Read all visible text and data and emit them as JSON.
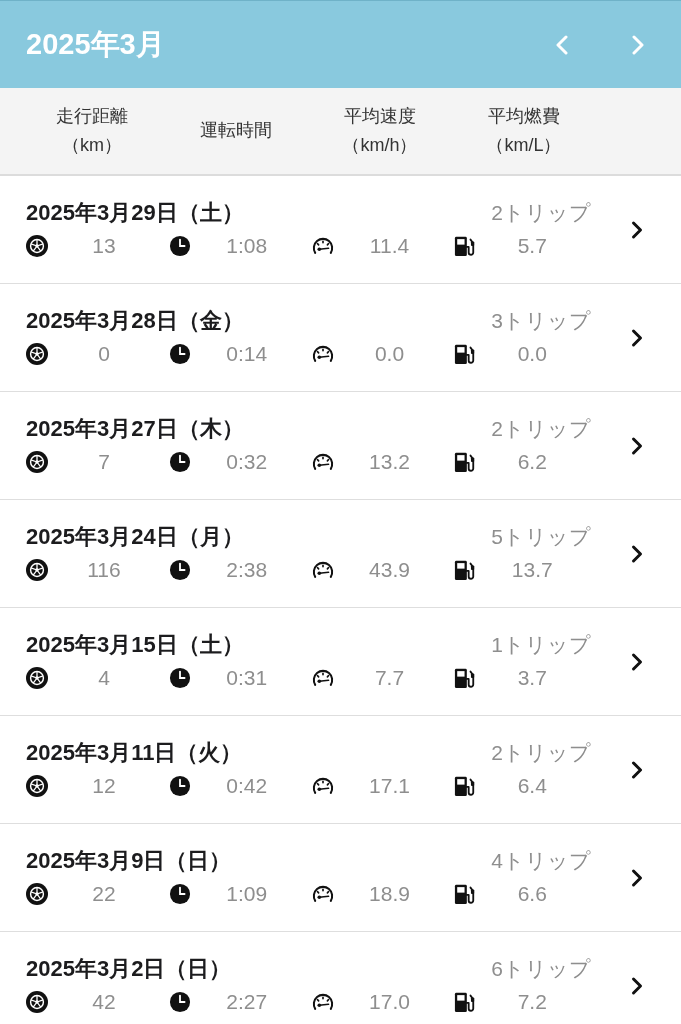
{
  "header": {
    "title": "2025年3月"
  },
  "columns": [
    {
      "label": "走行距離",
      "unit": "（km）"
    },
    {
      "label": "運転時間"
    },
    {
      "label": "平均速度",
      "unit": "（km/h）"
    },
    {
      "label": "平均燃費",
      "unit": "（km/L）"
    }
  ],
  "days": [
    {
      "date": "2025年3月29日（土）",
      "trips": "2トリップ",
      "distance": "13",
      "time": "1:08",
      "speed": "11.4",
      "fuel_economy": "5.7"
    },
    {
      "date": "2025年3月28日（金）",
      "trips": "3トリップ",
      "distance": "0",
      "time": "0:14",
      "speed": "0.0",
      "fuel_economy": "0.0"
    },
    {
      "date": "2025年3月27日（木）",
      "trips": "2トリップ",
      "distance": "7",
      "time": "0:32",
      "speed": "13.2",
      "fuel_economy": "6.2"
    },
    {
      "date": "2025年3月24日（月）",
      "trips": "5トリップ",
      "distance": "116",
      "time": "2:38",
      "speed": "43.9",
      "fuel_economy": "13.7"
    },
    {
      "date": "2025年3月15日（土）",
      "trips": "1トリップ",
      "distance": "4",
      "time": "0:31",
      "speed": "7.7",
      "fuel_economy": "3.7"
    },
    {
      "date": "2025年3月11日（火）",
      "trips": "2トリップ",
      "distance": "12",
      "time": "0:42",
      "speed": "17.1",
      "fuel_economy": "6.4"
    },
    {
      "date": "2025年3月9日（日）",
      "trips": "4トリップ",
      "distance": "22",
      "time": "1:09",
      "speed": "18.9",
      "fuel_economy": "6.6"
    },
    {
      "date": "2025年3月2日（日）",
      "trips": "6トリップ",
      "distance": "42",
      "time": "2:27",
      "speed": "17.0",
      "fuel_economy": "7.2"
    }
  ]
}
